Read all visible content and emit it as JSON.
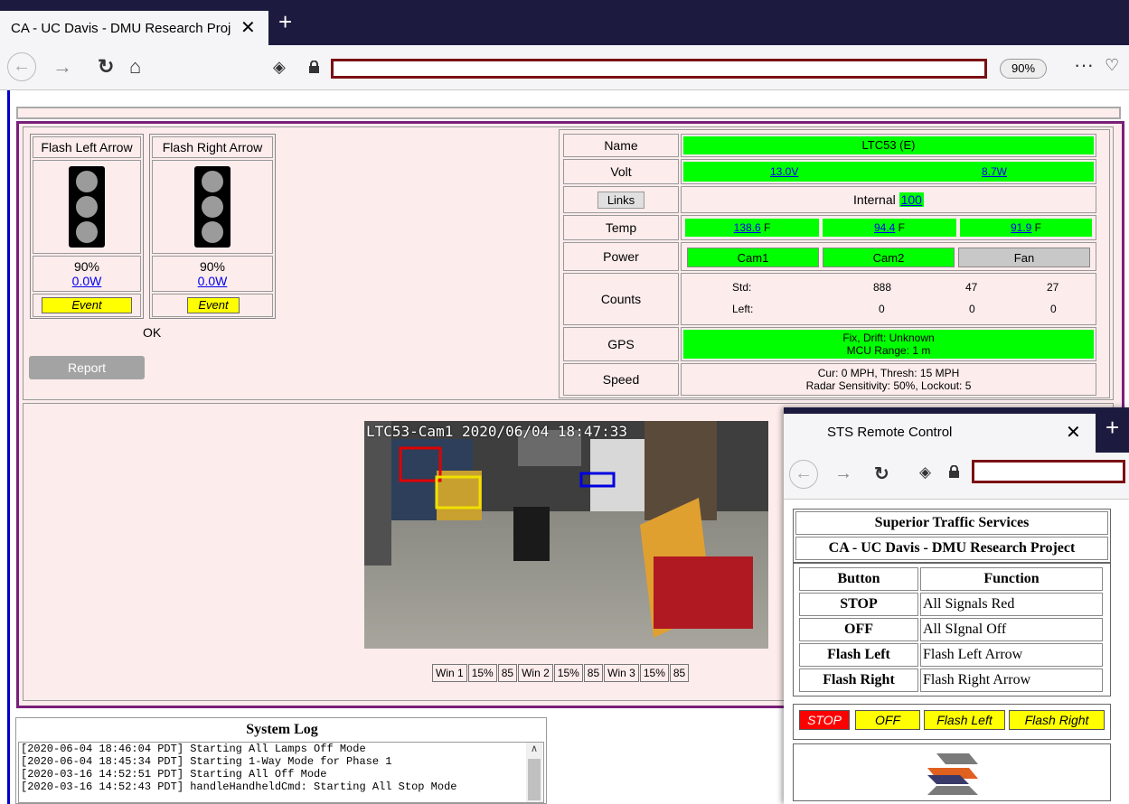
{
  "browser": {
    "tab_title": "CA - UC Davis - DMU Research Proj",
    "zoom": "90%"
  },
  "lamps": [
    {
      "title": "Flash Left Arrow",
      "percent": "90%",
      "power": "0.0W",
      "event": "Event"
    },
    {
      "title": "Flash Right Arrow",
      "percent": "90%",
      "power": "0.0W",
      "event": "Event"
    }
  ],
  "lamp_status": "OK",
  "report_button": "Report",
  "status": {
    "name_label": "Name",
    "name_value": "LTC53 (E)",
    "volt_label": "Volt",
    "volt_1": "13.0V",
    "volt_2": "8.7W",
    "links_button": "Links",
    "links_text": "Internal",
    "links_value": "100",
    "temp_label": "Temp",
    "temps": [
      {
        "value": "138.6",
        "unit": " F"
      },
      {
        "value": "94.4",
        "unit": " F"
      },
      {
        "value": "91.9",
        "unit": " F"
      }
    ],
    "power_label": "Power",
    "power_cam1": "Cam1",
    "power_cam2": "Cam2",
    "power_fan": "Fan",
    "counts_label": "Counts",
    "counts_std_label": "Std:",
    "counts_std": [
      "888",
      "47",
      "27"
    ],
    "counts_left_label": "Left:",
    "counts_left": [
      "0",
      "0",
      "0"
    ],
    "gps_label": "GPS",
    "gps_line1": "Fix, Drift: Unknown",
    "gps_line2": "MCU Range: 1 m",
    "speed_label": "Speed",
    "speed_line1": "Cur: 0 MPH, Thresh: 15 MPH",
    "speed_line2": "Radar Sensitivity: 50%, Lockout: 5"
  },
  "camera": {
    "overlay": "LTC53-Cam1 2020/06/04 18:47:33",
    "windows": [
      "Win 1",
      "15%",
      "85",
      "Win 2",
      "15%",
      "85",
      "Win 3",
      "15%",
      "85"
    ]
  },
  "system_log": {
    "title": "System Log",
    "lines": [
      "[2020-06-04 18:46:04 PDT] Starting All Lamps Off Mode",
      "[2020-06-04 18:45:34 PDT] Starting 1-Way Mode for Phase 1",
      "[2020-03-16 14:52:51 PDT] Starting All Off Mode",
      "[2020-03-16 14:52:43 PDT] handleHandheldCmd: Starting All Stop Mode"
    ]
  },
  "popup": {
    "tab_title": "STS Remote Control",
    "company": "Superior Traffic Services",
    "project": "CA - UC Davis - DMU Research Project",
    "col_button": "Button",
    "col_function": "Function",
    "rows": [
      {
        "button": "STOP",
        "function": "All Signals Red"
      },
      {
        "button": "OFF",
        "function": "All SIgnal Off"
      },
      {
        "button": "Flash Left",
        "function": "Flash Left Arrow"
      },
      {
        "button": "Flash Right",
        "function": "Flash Right Arrow"
      }
    ],
    "controls": [
      "STOP",
      "OFF",
      "Flash Left",
      "Flash Right"
    ]
  },
  "colors": {
    "accent_green": "#00ff00",
    "stop_red": "#ff0000",
    "event_yellow": "#ffff00",
    "url_border": "#7b1113"
  }
}
